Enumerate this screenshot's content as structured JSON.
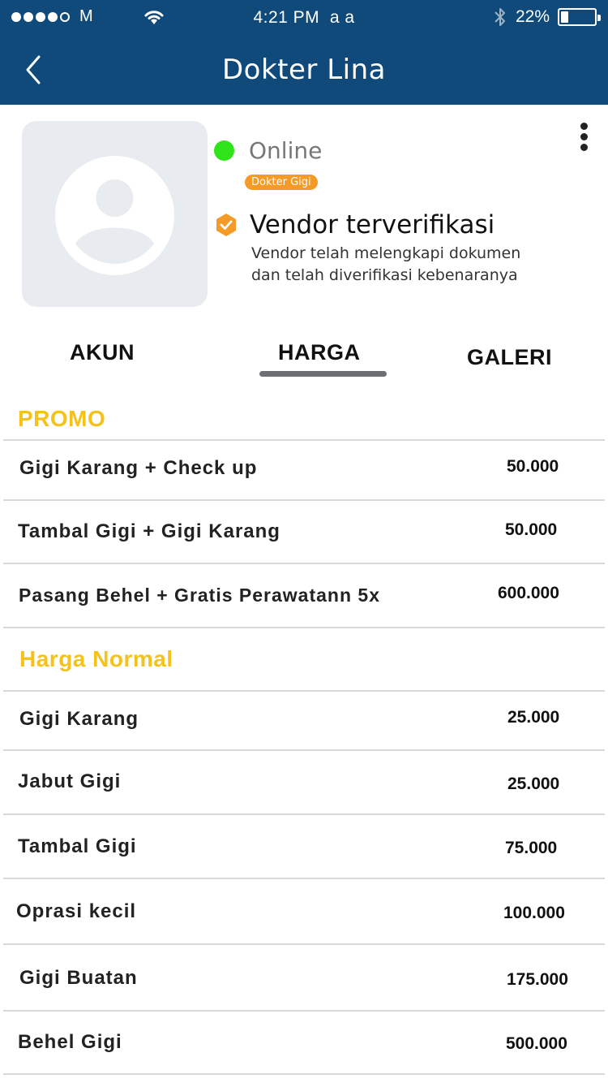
{
  "status_bar": {
    "carrier": "M",
    "time": "4:21 PM",
    "extra": "a a",
    "battery": "22%",
    "battery_level": 0.22
  },
  "nav": {
    "title": "Dokter Lina"
  },
  "profile": {
    "online_label": "Online",
    "badge": "Dokter Gigi",
    "verified_title": "Vendor terverifikasi",
    "verified_desc_line1": "Vendor telah melengkapi dokumen",
    "verified_desc_line2": "dan telah diverifikasi kebenaranya",
    "colors": {
      "online": "#2fe41a",
      "badge": "#f49a27",
      "verified": "#f49a27"
    }
  },
  "tabs": [
    {
      "label": "AKUN"
    },
    {
      "label": "HARGA",
      "active": true
    },
    {
      "label": "GALERI"
    }
  ],
  "promo": {
    "title": "PROMO",
    "items": [
      {
        "name": "Gigi Karang + Check up",
        "price": "50.000"
      },
      {
        "name": "Tambal Gigi + Gigi Karang",
        "price": "50.000"
      },
      {
        "name": "Pasang Behel + Gratis Perawatann 5x",
        "price": "600.000"
      }
    ]
  },
  "normal": {
    "title": "Harga Normal",
    "items": [
      {
        "name": "Gigi Karang",
        "price": "25.000"
      },
      {
        "name": "Jabut Gigi",
        "price": "25.000"
      },
      {
        "name": "Tambal Gigi",
        "price": "75.000"
      },
      {
        "name": "Oprasi kecil",
        "price": "100.000"
      },
      {
        "name": "Gigi Buatan",
        "price": "175.000"
      },
      {
        "name": "Behel Gigi",
        "price": "500.000"
      }
    ]
  },
  "theme": {
    "header_bg": "#0f4a7a",
    "section_title": "#f4c21a",
    "divider": "#d7d9dc"
  }
}
